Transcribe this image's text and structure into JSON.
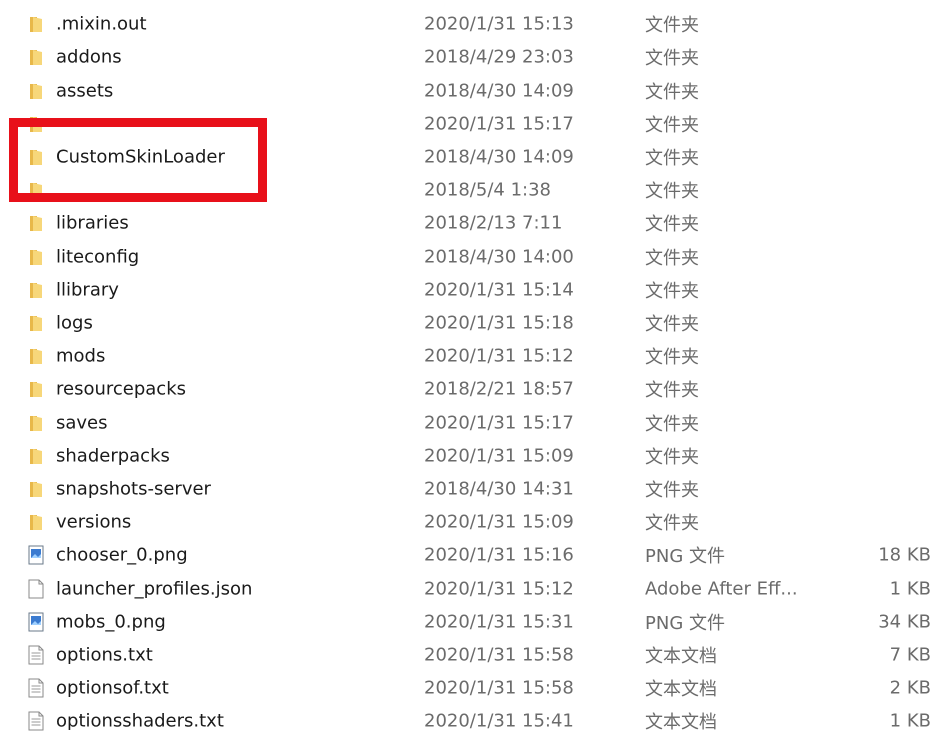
{
  "files": [
    {
      "name": ".mixin.out",
      "date": "2020/1/31 15:13",
      "type": "文件夹",
      "size": "",
      "icon": "folder-icon"
    },
    {
      "name": "addons",
      "date": "2018/4/29 23:03",
      "type": "文件夹",
      "size": "",
      "icon": "folder-icon"
    },
    {
      "name": "assets",
      "date": "2018/4/30 14:09",
      "type": "文件夹",
      "size": "",
      "icon": "folder-icon"
    },
    {
      "name": "",
      "date": "2020/1/31 15:17",
      "type": "文件夹",
      "size": "",
      "icon": "folder-icon"
    },
    {
      "name": "CustomSkinLoader",
      "date": "2018/4/30 14:09",
      "type": "文件夹",
      "size": "",
      "icon": "folder-icon"
    },
    {
      "name": "",
      "date": "2018/5/4 1:38",
      "type": "文件夹",
      "size": "",
      "icon": "folder-icon"
    },
    {
      "name": "libraries",
      "date": "2018/2/13 7:11",
      "type": "文件夹",
      "size": "",
      "icon": "folder-icon"
    },
    {
      "name": "liteconfig",
      "date": "2018/4/30 14:00",
      "type": "文件夹",
      "size": "",
      "icon": "folder-icon"
    },
    {
      "name": "llibrary",
      "date": "2020/1/31 15:14",
      "type": "文件夹",
      "size": "",
      "icon": "folder-icon"
    },
    {
      "name": "logs",
      "date": "2020/1/31 15:18",
      "type": "文件夹",
      "size": "",
      "icon": "folder-icon"
    },
    {
      "name": "mods",
      "date": "2020/1/31 15:12",
      "type": "文件夹",
      "size": "",
      "icon": "folder-icon"
    },
    {
      "name": "resourcepacks",
      "date": "2018/2/21 18:57",
      "type": "文件夹",
      "size": "",
      "icon": "folder-icon"
    },
    {
      "name": "saves",
      "date": "2020/1/31 15:17",
      "type": "文件夹",
      "size": "",
      "icon": "folder-icon"
    },
    {
      "name": "shaderpacks",
      "date": "2020/1/31 15:09",
      "type": "文件夹",
      "size": "",
      "icon": "folder-icon"
    },
    {
      "name": "snapshots-server",
      "date": "2018/4/30 14:31",
      "type": "文件夹",
      "size": "",
      "icon": "folder-icon"
    },
    {
      "name": "versions",
      "date": "2020/1/31 15:09",
      "type": "文件夹",
      "size": "",
      "icon": "folder-icon"
    },
    {
      "name": "chooser_0.png",
      "date": "2020/1/31 15:16",
      "type": "PNG 文件",
      "size": "18 KB",
      "icon": "image-file-icon"
    },
    {
      "name": "launcher_profiles.json",
      "date": "2020/1/31 15:12",
      "type": "Adobe After Eff...",
      "size": "1 KB",
      "icon": "blank-file-icon"
    },
    {
      "name": "mobs_0.png",
      "date": "2020/1/31 15:31",
      "type": "PNG 文件",
      "size": "34 KB",
      "icon": "image-file-icon"
    },
    {
      "name": "options.txt",
      "date": "2020/1/31 15:58",
      "type": "文本文档",
      "size": "7 KB",
      "icon": "text-file-icon"
    },
    {
      "name": "optionsof.txt",
      "date": "2020/1/31 15:58",
      "type": "文本文档",
      "size": "2 KB",
      "icon": "text-file-icon"
    },
    {
      "name": "optionsshaders.txt",
      "date": "2020/1/31 15:41",
      "type": "文本文档",
      "size": "1 KB",
      "icon": "text-file-icon"
    }
  ],
  "highlight": {
    "color": "#e8101a",
    "label": "CustomSkinLoader"
  },
  "colors": {
    "folder": "#f2c94c",
    "text": "#1a1a1a",
    "meta": "#6b6b6b"
  }
}
